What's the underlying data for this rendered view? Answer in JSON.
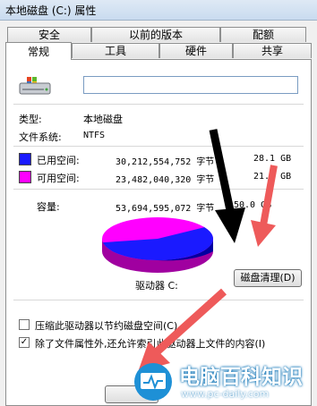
{
  "window": {
    "title": "本地磁盘 (C:) 属性"
  },
  "tabs_row1": [
    {
      "label": "安全"
    },
    {
      "label": "以前的版本"
    },
    {
      "label": "配额"
    }
  ],
  "tabs_row2": [
    {
      "label": "常规"
    },
    {
      "label": "工具"
    },
    {
      "label": "硬件"
    },
    {
      "label": "共享"
    }
  ],
  "general": {
    "name_value": "",
    "type_label": "类型:",
    "type_value": "本地磁盘",
    "fs_label": "文件系统:",
    "fs_value": "NTFS",
    "used": {
      "label": "已用空间:",
      "bytes": "30,212,554,752 字节",
      "size": "28.1 GB",
      "color": "#1a1aff"
    },
    "free": {
      "label": "可用空间:",
      "bytes": "23,482,040,320 字节",
      "size": "21.8 GB",
      "color": "#ff00ff"
    },
    "capacity": {
      "label": "容量:",
      "bytes": "53,694,595,072 字节",
      "size": "50.0 GB"
    },
    "drive_label": "驱动器 C:",
    "cleanup_button": "磁盘清理(D)",
    "used_fraction": 0.563,
    "compress_option": {
      "label": "压缩此驱动器以节约磁盘空间(C)",
      "checked": false
    },
    "index_option": {
      "label": "除了文件属性外,还允许索引此驱动器上文件的内容(I)",
      "checked": true
    }
  },
  "watermark": {
    "text": "电脑百科知识",
    "url": "www.pc-daily.com"
  }
}
